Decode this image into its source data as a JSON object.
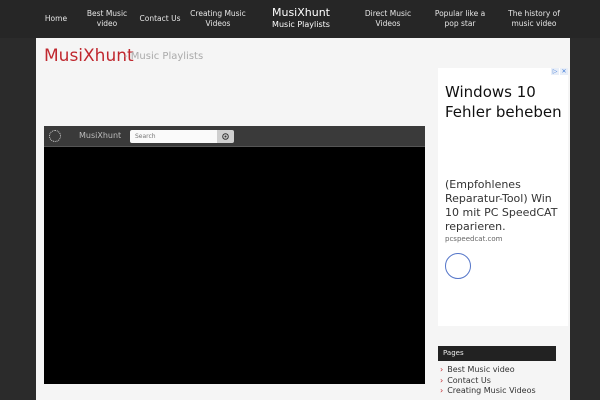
{
  "nav": {
    "items": [
      {
        "label": "Home"
      },
      {
        "label": "Best Music video"
      },
      {
        "label": "Contact Us"
      },
      {
        "label": "Creating Music Videos"
      },
      {
        "label": "Direct Music Videos"
      },
      {
        "label": "Popular like a pop star"
      },
      {
        "label": "The history of music video"
      }
    ],
    "brand_title": "MusiXhunt",
    "brand_subtitle": "Music Playlists"
  },
  "header": {
    "site_title": "MusiXhunt",
    "site_subtitle": "- Music Playlists"
  },
  "player": {
    "brand": "MusiXhunt",
    "search_placeholder": "Search"
  },
  "ad": {
    "headline": "Windows 10 Fehler beheben",
    "description": "(Empfohlenes Reparatur-Tool) Win 10 mit PC SpeedCAT reparieren.",
    "url": "pcspeedcat.com"
  },
  "sidebar": {
    "pages_title": "Pages",
    "pages": [
      {
        "label": "Best Music video"
      },
      {
        "label": "Contact Us"
      },
      {
        "label": "Creating Music Videos"
      }
    ]
  },
  "colors": {
    "accent": "#c0282f",
    "nav_bg": "#262626",
    "page_bg": "#f5f5f5"
  }
}
